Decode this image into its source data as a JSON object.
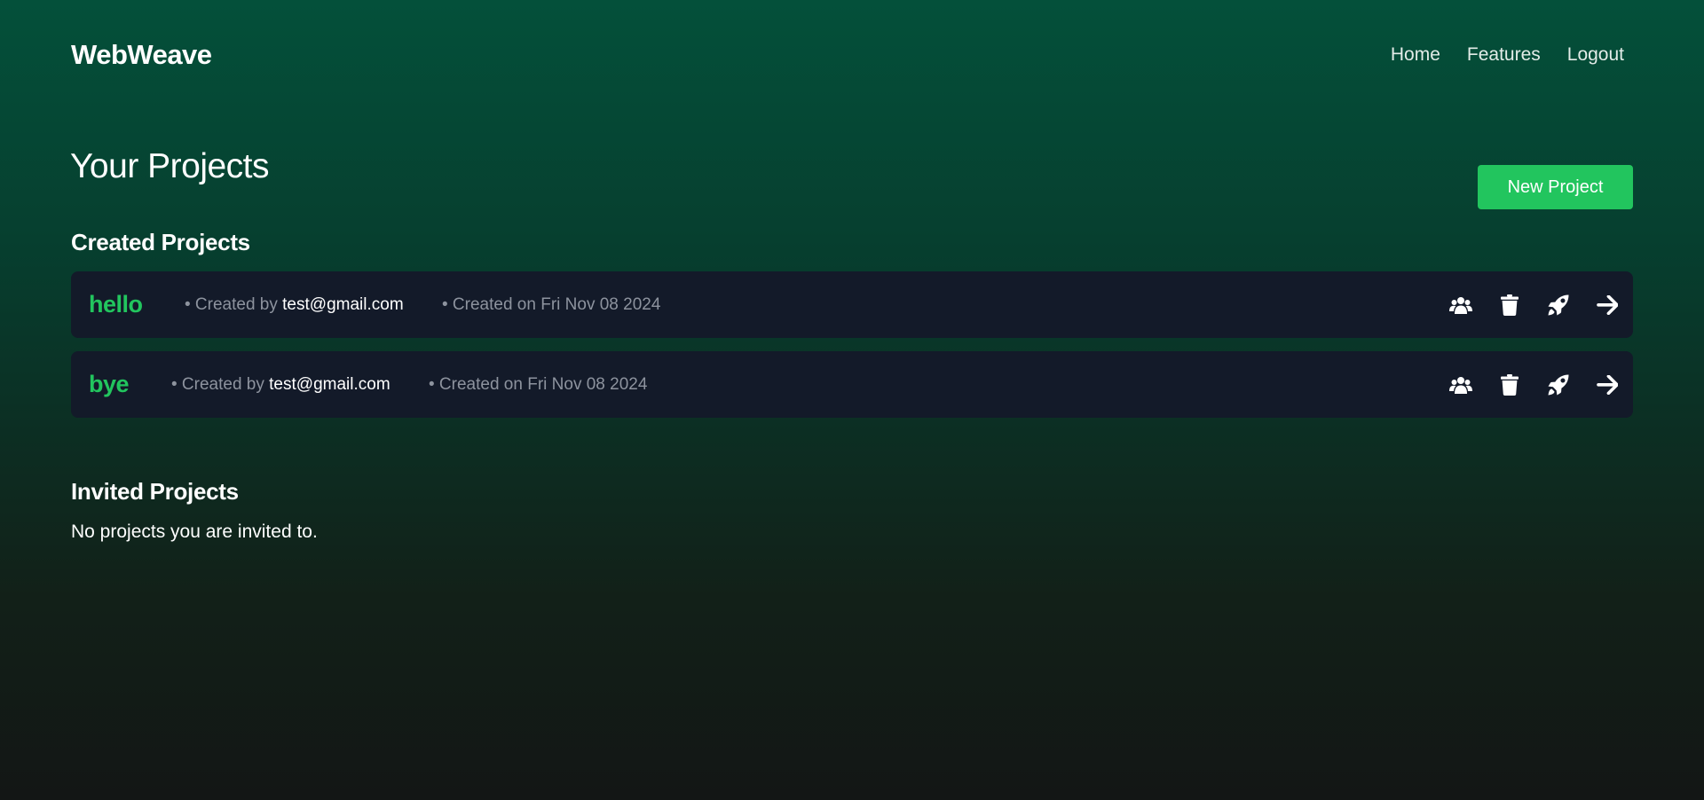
{
  "app": {
    "brand": "WebWeave"
  },
  "nav": {
    "items": [
      {
        "label": "Home"
      },
      {
        "label": "Features"
      },
      {
        "label": "Logout"
      }
    ]
  },
  "page": {
    "title": "Your Projects",
    "new_project_label": "New Project"
  },
  "created": {
    "title": "Created Projects",
    "projects": [
      {
        "name": "hello",
        "created_by_prefix": "• Created by",
        "owner": "test@gmail.com",
        "created_on": "• Created on Fri Nov 08 2024"
      },
      {
        "name": "bye",
        "created_by_prefix": "• Created by",
        "owner": "test@gmail.com",
        "created_on": "• Created on Fri Nov 08 2024"
      }
    ]
  },
  "invited": {
    "title": "Invited Projects",
    "empty_text": "No projects you are invited to."
  },
  "icons": {
    "collaborators": "users-icon",
    "delete": "trash-icon",
    "deploy": "rocket-icon",
    "open": "arrow-right-icon"
  },
  "colors": {
    "accent": "#22c55e",
    "card_background": "#131a29",
    "muted_text": "#8d939e"
  }
}
